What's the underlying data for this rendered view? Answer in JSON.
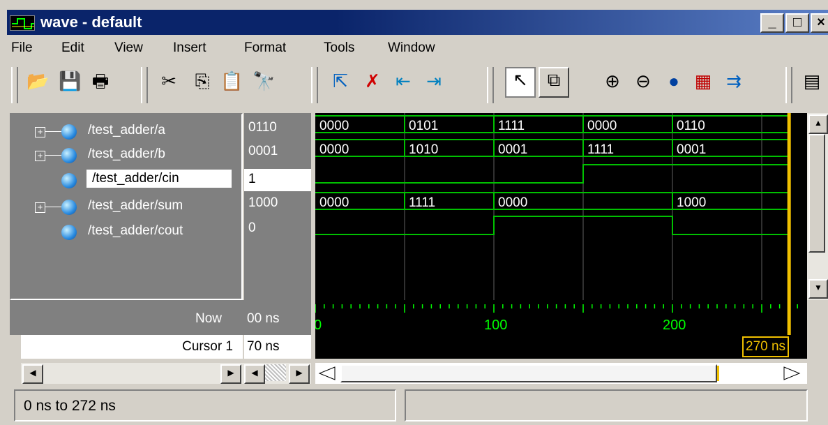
{
  "window": {
    "title": "wave - default",
    "controls": {
      "minimize": "_",
      "maximize": "□",
      "close": "×"
    }
  },
  "menu": [
    "File",
    "Edit",
    "View",
    "Insert",
    "Format",
    "Tools",
    "Window"
  ],
  "toolbar": {
    "icons": [
      "open-folder-icon",
      "save-icon",
      "print-icon",
      "cut-icon",
      "copy-icon",
      "paste-icon",
      "find-icon",
      "select-pointer-icon",
      "delete-cursor-icon",
      "prev-edge-icon",
      "next-edge-icon",
      "pointer-mode-icon",
      "zoom-mode-icon",
      "zoom-in-icon",
      "zoom-out-icon",
      "zoom-full-icon",
      "add-cursor-icon",
      "cursor-jump-icon",
      "properties-icon"
    ]
  },
  "signals": [
    {
      "name": "/test_adder/a",
      "value": "0110",
      "expandable": true,
      "selected": false
    },
    {
      "name": "/test_adder/b",
      "value": "0001",
      "expandable": true,
      "selected": false
    },
    {
      "name": "/test_adder/cin",
      "value": "1",
      "expandable": false,
      "selected": true
    },
    {
      "name": "/test_adder/sum",
      "value": "1000",
      "expandable": true,
      "selected": false
    },
    {
      "name": "/test_adder/cout",
      "value": "0",
      "expandable": false,
      "selected": false
    }
  ],
  "waves": {
    "time_range": [
      0,
      272
    ],
    "buses": [
      {
        "signal": "/test_adder/a",
        "segments": [
          {
            "t": 0,
            "v": "0000"
          },
          {
            "t": 50,
            "v": "0101"
          },
          {
            "t": 100,
            "v": "1111"
          },
          {
            "t": 150,
            "v": "0000"
          },
          {
            "t": 200,
            "v": "0110"
          }
        ]
      },
      {
        "signal": "/test_adder/b",
        "segments": [
          {
            "t": 0,
            "v": "0000"
          },
          {
            "t": 50,
            "v": "1010"
          },
          {
            "t": 100,
            "v": "0001"
          },
          {
            "t": 150,
            "v": "1111"
          },
          {
            "t": 200,
            "v": "0001"
          }
        ]
      },
      {
        "signal": "/test_adder/sum",
        "segments": [
          {
            "t": 0,
            "v": "0000"
          },
          {
            "t": 50,
            "v": "1111"
          },
          {
            "t": 100,
            "v": "0000"
          },
          {
            "t": 200,
            "v": "1000"
          }
        ]
      }
    ],
    "bits": [
      {
        "signal": "/test_adder/cin",
        "transitions": [
          {
            "t": 0,
            "v": 0
          },
          {
            "t": 150,
            "v": 1
          }
        ]
      },
      {
        "signal": "/test_adder/cout",
        "transitions": [
          {
            "t": 0,
            "v": 0
          },
          {
            "t": 100,
            "v": 1
          },
          {
            "t": 200,
            "v": 0
          }
        ]
      }
    ]
  },
  "timeline": {
    "now_label": "Now",
    "now_value": "00 ns",
    "tick_labels": [
      "0",
      "100",
      "200"
    ],
    "cursor_label": "Cursor 1",
    "cursor_value": "70 ns",
    "cursor_marker": "270 ns"
  },
  "status": {
    "range": "0 ns to 272 ns"
  },
  "colors": {
    "wave": "#00c000",
    "cursor": "#f0c000",
    "timeline_text": "#00ff00"
  }
}
